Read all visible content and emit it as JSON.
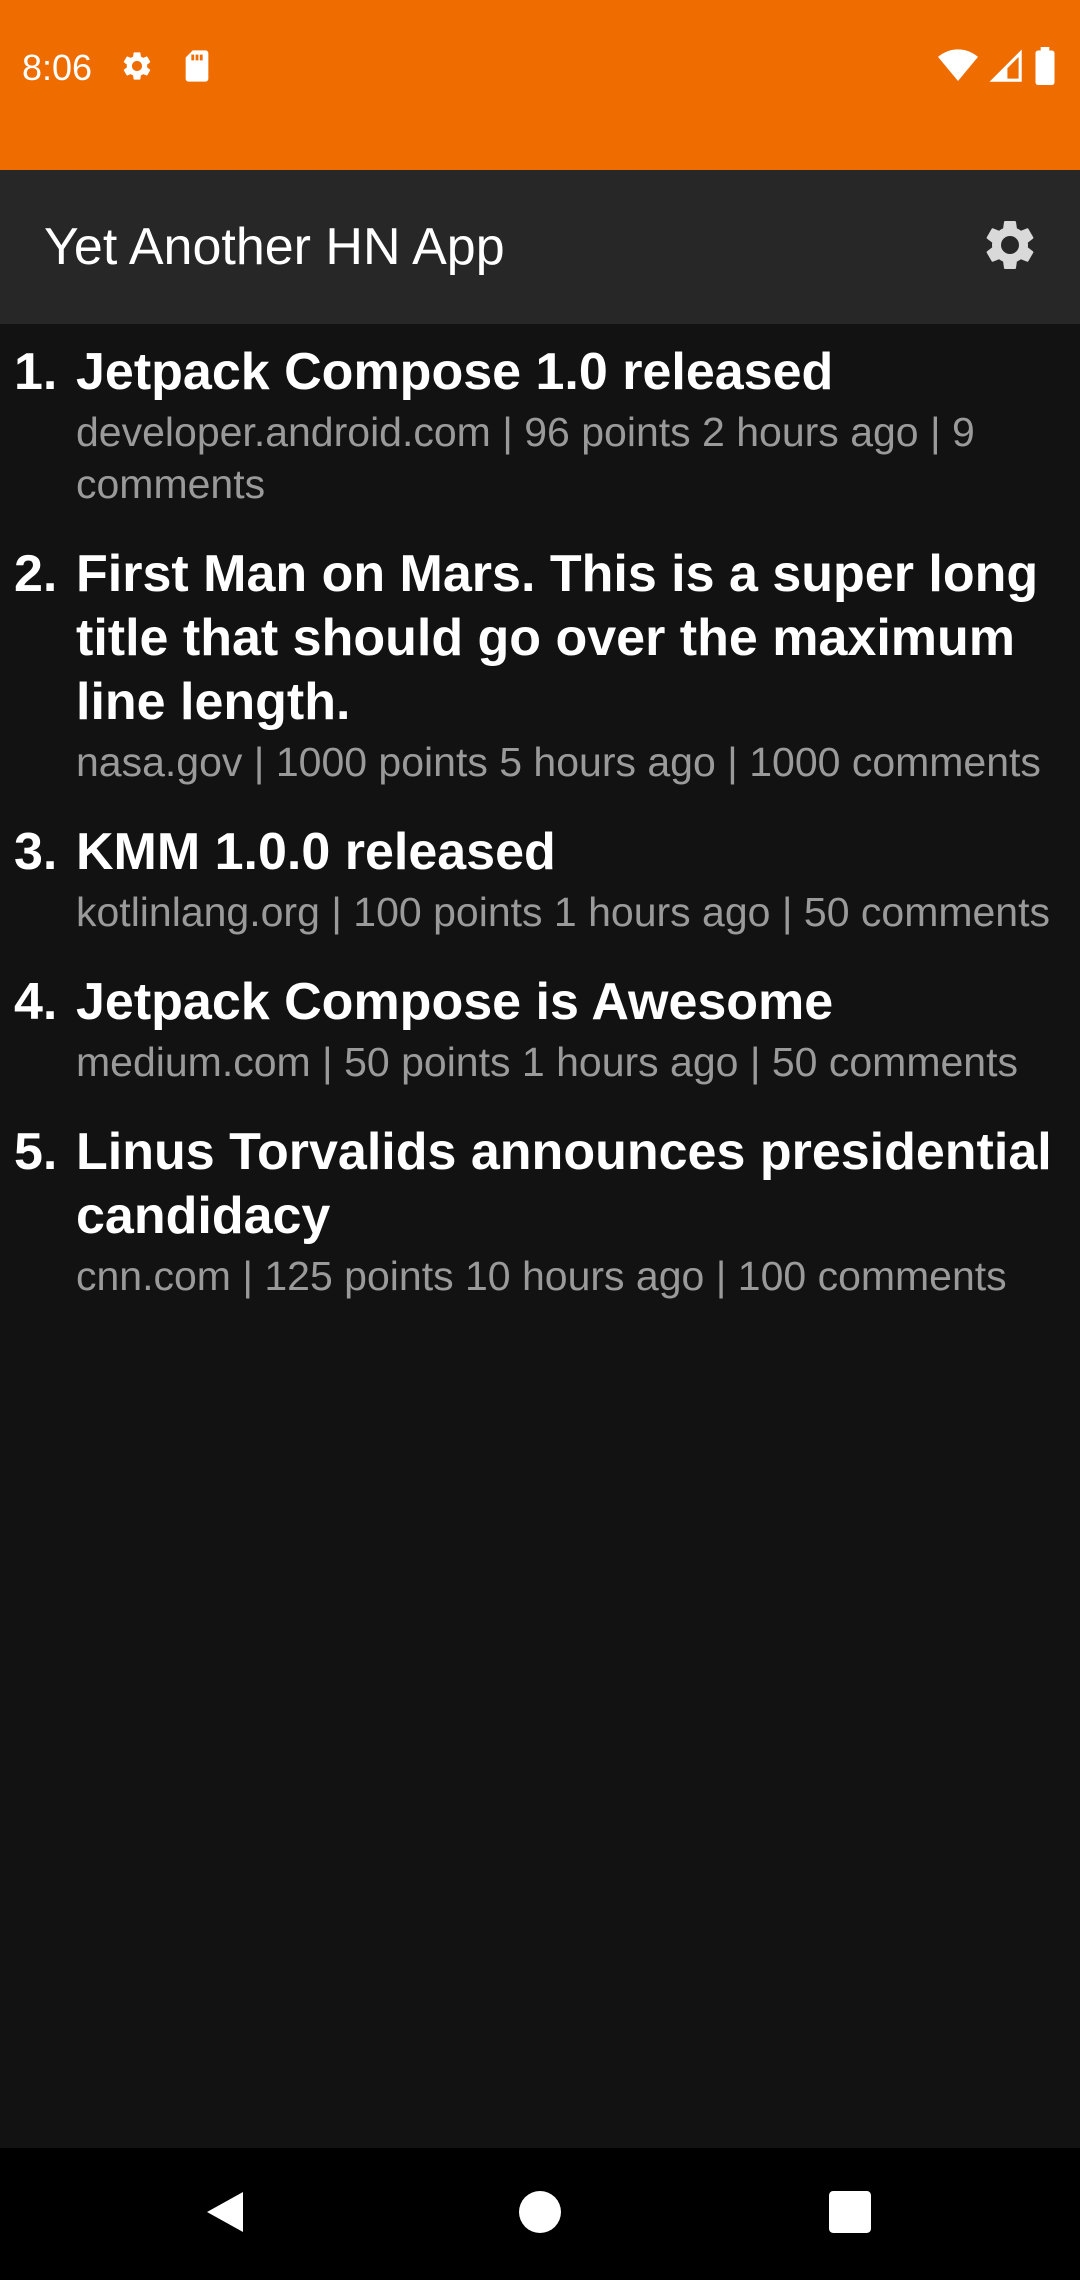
{
  "status_bar": {
    "time": "8:06",
    "left_icons": [
      "gear-icon",
      "sd-card-icon"
    ],
    "right_icons": [
      "wifi-icon",
      "signal-icon",
      "battery-icon"
    ],
    "color": "#EF6C00"
  },
  "app_bar": {
    "title": "Yet Another HN App",
    "settings_icon": "gear-icon",
    "color": "#272727"
  },
  "stories": [
    {
      "rank": "1.",
      "title": "Jetpack Compose 1.0 released",
      "meta": "developer.android.com | 96 points 2 hours ago | 9 comments"
    },
    {
      "rank": "2.",
      "title": "First Man on Mars. This is a super long title that should go over the maximum line length.",
      "meta": "nasa.gov | 1000 points 5 hours ago | 1000 comments"
    },
    {
      "rank": "3.",
      "title": "KMM 1.0.0 released",
      "meta": "kotlinlang.org | 100 points 1 hours ago | 50 comments"
    },
    {
      "rank": "4.",
      "title": "Jetpack Compose is Awesome",
      "meta": "medium.com | 50 points 1 hours ago | 50 comments"
    },
    {
      "rank": "5.",
      "title": "Linus Torvalids announces presidential candidacy",
      "meta": "cnn.com | 125 points 10 hours ago | 100 comments"
    }
  ],
  "nav_bar": {
    "icons": [
      "back-icon",
      "home-icon",
      "recents-icon"
    ]
  }
}
